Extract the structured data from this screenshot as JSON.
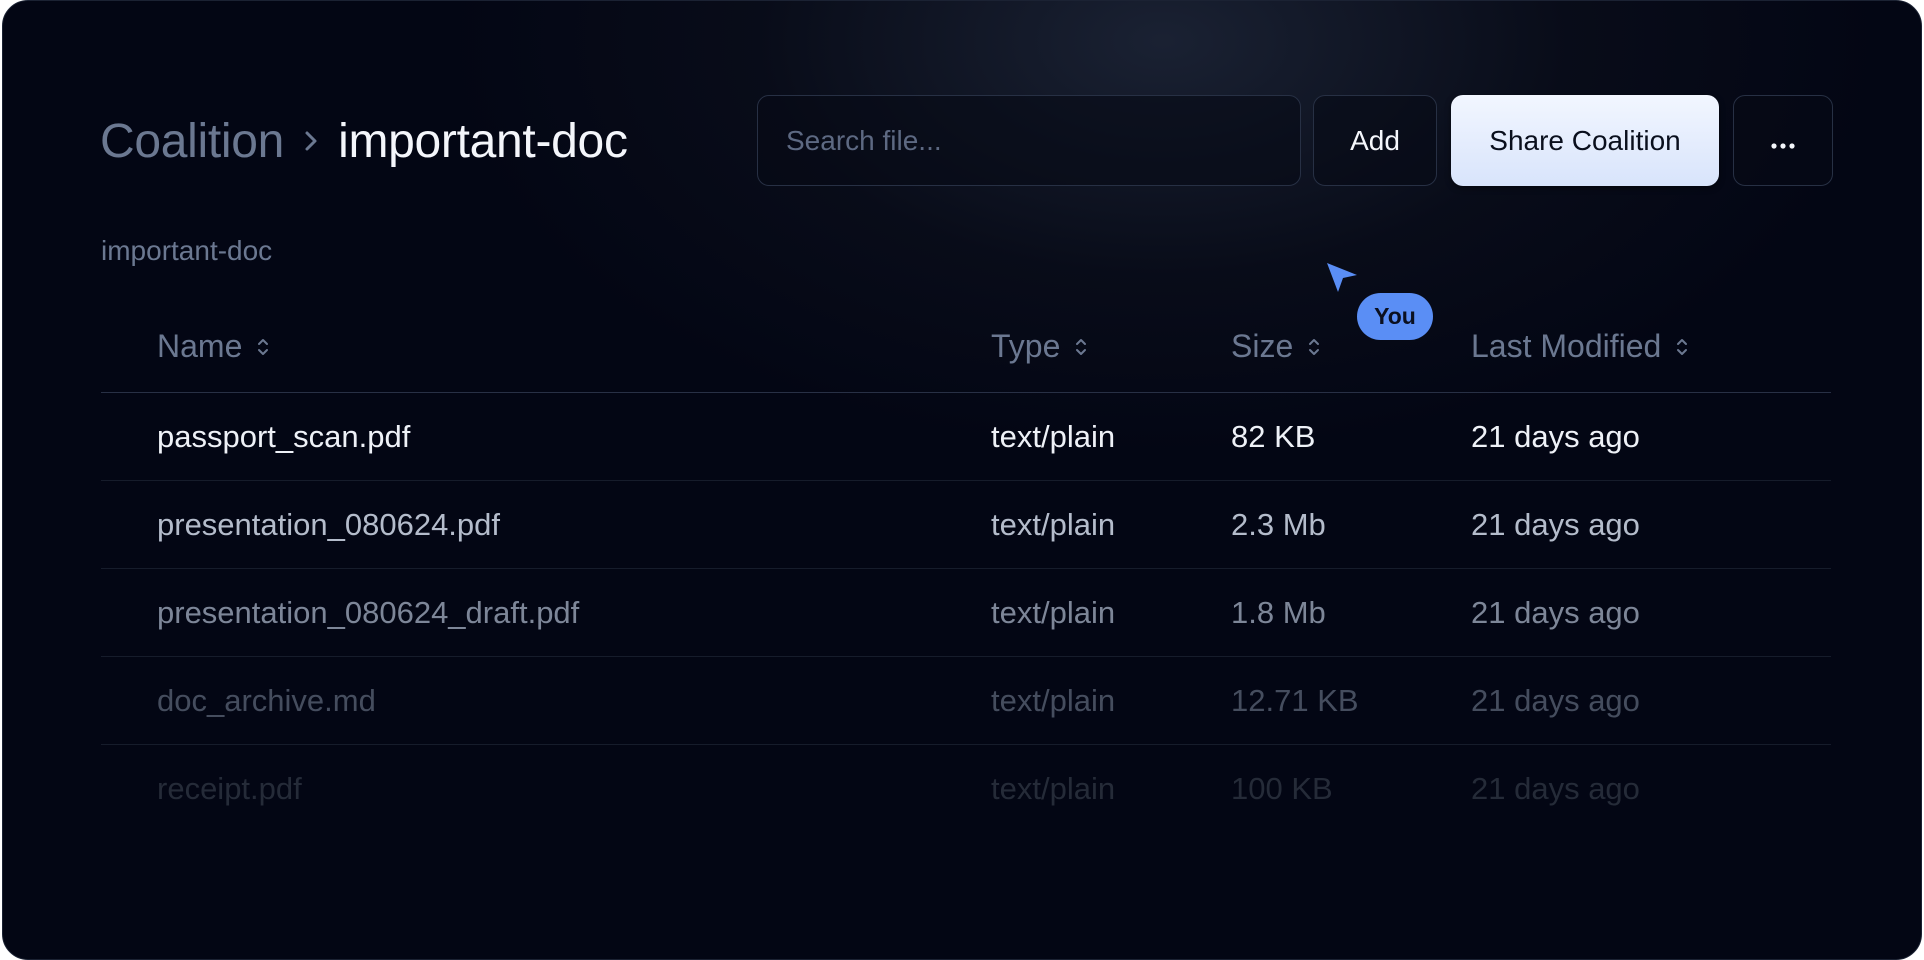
{
  "breadcrumb": {
    "root": "Coalition",
    "current": "important-doc"
  },
  "search": {
    "placeholder": "Search file..."
  },
  "toolbar": {
    "add_label": "Add",
    "share_label": "Share Coalition",
    "more_label": "···"
  },
  "folder_label": "important-doc",
  "presence": {
    "cursor_label": "You"
  },
  "colors": {
    "accent": "#5a8ef5",
    "background": "#030614",
    "share_button": "#e4ecfd"
  },
  "table": {
    "columns": [
      "Name",
      "Type",
      "Size",
      "Last Modified"
    ],
    "rows": [
      {
        "name": "passport_scan.pdf",
        "type": "text/plain",
        "size": "82 KB",
        "modified": "21 days ago"
      },
      {
        "name": "presentation_080624.pdf",
        "type": "text/plain",
        "size": "2.3 Mb",
        "modified": "21 days ago"
      },
      {
        "name": "presentation_080624_draft.pdf",
        "type": "text/plain",
        "size": "1.8 Mb",
        "modified": "21 days ago"
      },
      {
        "name": "doc_archive.md",
        "type": "text/plain",
        "size": "12.71 KB",
        "modified": "21 days ago"
      },
      {
        "name": "receipt.pdf",
        "type": "text/plain",
        "size": "100 KB",
        "modified": "21 days ago"
      }
    ]
  }
}
